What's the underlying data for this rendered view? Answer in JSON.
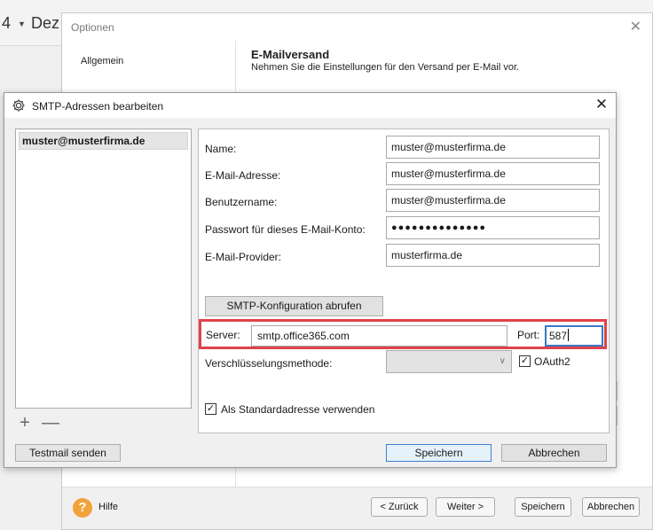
{
  "background_app": {
    "number": "4",
    "dropdown_text": "Dez"
  },
  "options_window": {
    "title": "Optionen",
    "nav_items": [
      "Allgemein"
    ],
    "section_title": "E-Mailversand",
    "section_subtitle": "Nehmen Sie die Einstellungen für den Versand per E-Mail vor.",
    "help_label": "Hilfe",
    "back_label": "< Zurück",
    "next_label": "Weiter >",
    "save_label": "Speichern",
    "cancel_label": "Abbrechen"
  },
  "smtp_dialog": {
    "title": "SMTP-Adressen bearbeiten",
    "accounts": [
      "muster@musterfirma.de"
    ],
    "test_mail_label": "Testmail senden",
    "form": {
      "name_label": "Name:",
      "name_value": "muster@musterfirma.de",
      "email_label": "E-Mail-Adresse:",
      "email_value": "muster@musterfirma.de",
      "username_label": "Benutzername:",
      "username_value": "muster@musterfirma.de",
      "password_label": "Passwort für dieses E-Mail-Konto:",
      "password_value": "●●●●●●●●●●●●●●",
      "provider_label": "E-Mail-Provider:",
      "provider_value": "musterfirma.de",
      "fetch_config_label": "SMTP-Konfiguration abrufen",
      "server_label": "Server:",
      "server_value": "smtp.office365.com",
      "port_label": "Port:",
      "port_value": "587",
      "encryption_label": "Verschlüsselungsmethode:",
      "encryption_value": "",
      "oauth_label": "OAuth2",
      "oauth_checked": true,
      "default_label": "Als Standardadresse verwenden",
      "default_checked": true
    },
    "save_label": "Speichern",
    "cancel_label": "Abbrechen"
  },
  "colors": {
    "highlight_border": "#e0424a",
    "focus_border": "#3b78c4",
    "help_icon": "#f2a23a"
  }
}
